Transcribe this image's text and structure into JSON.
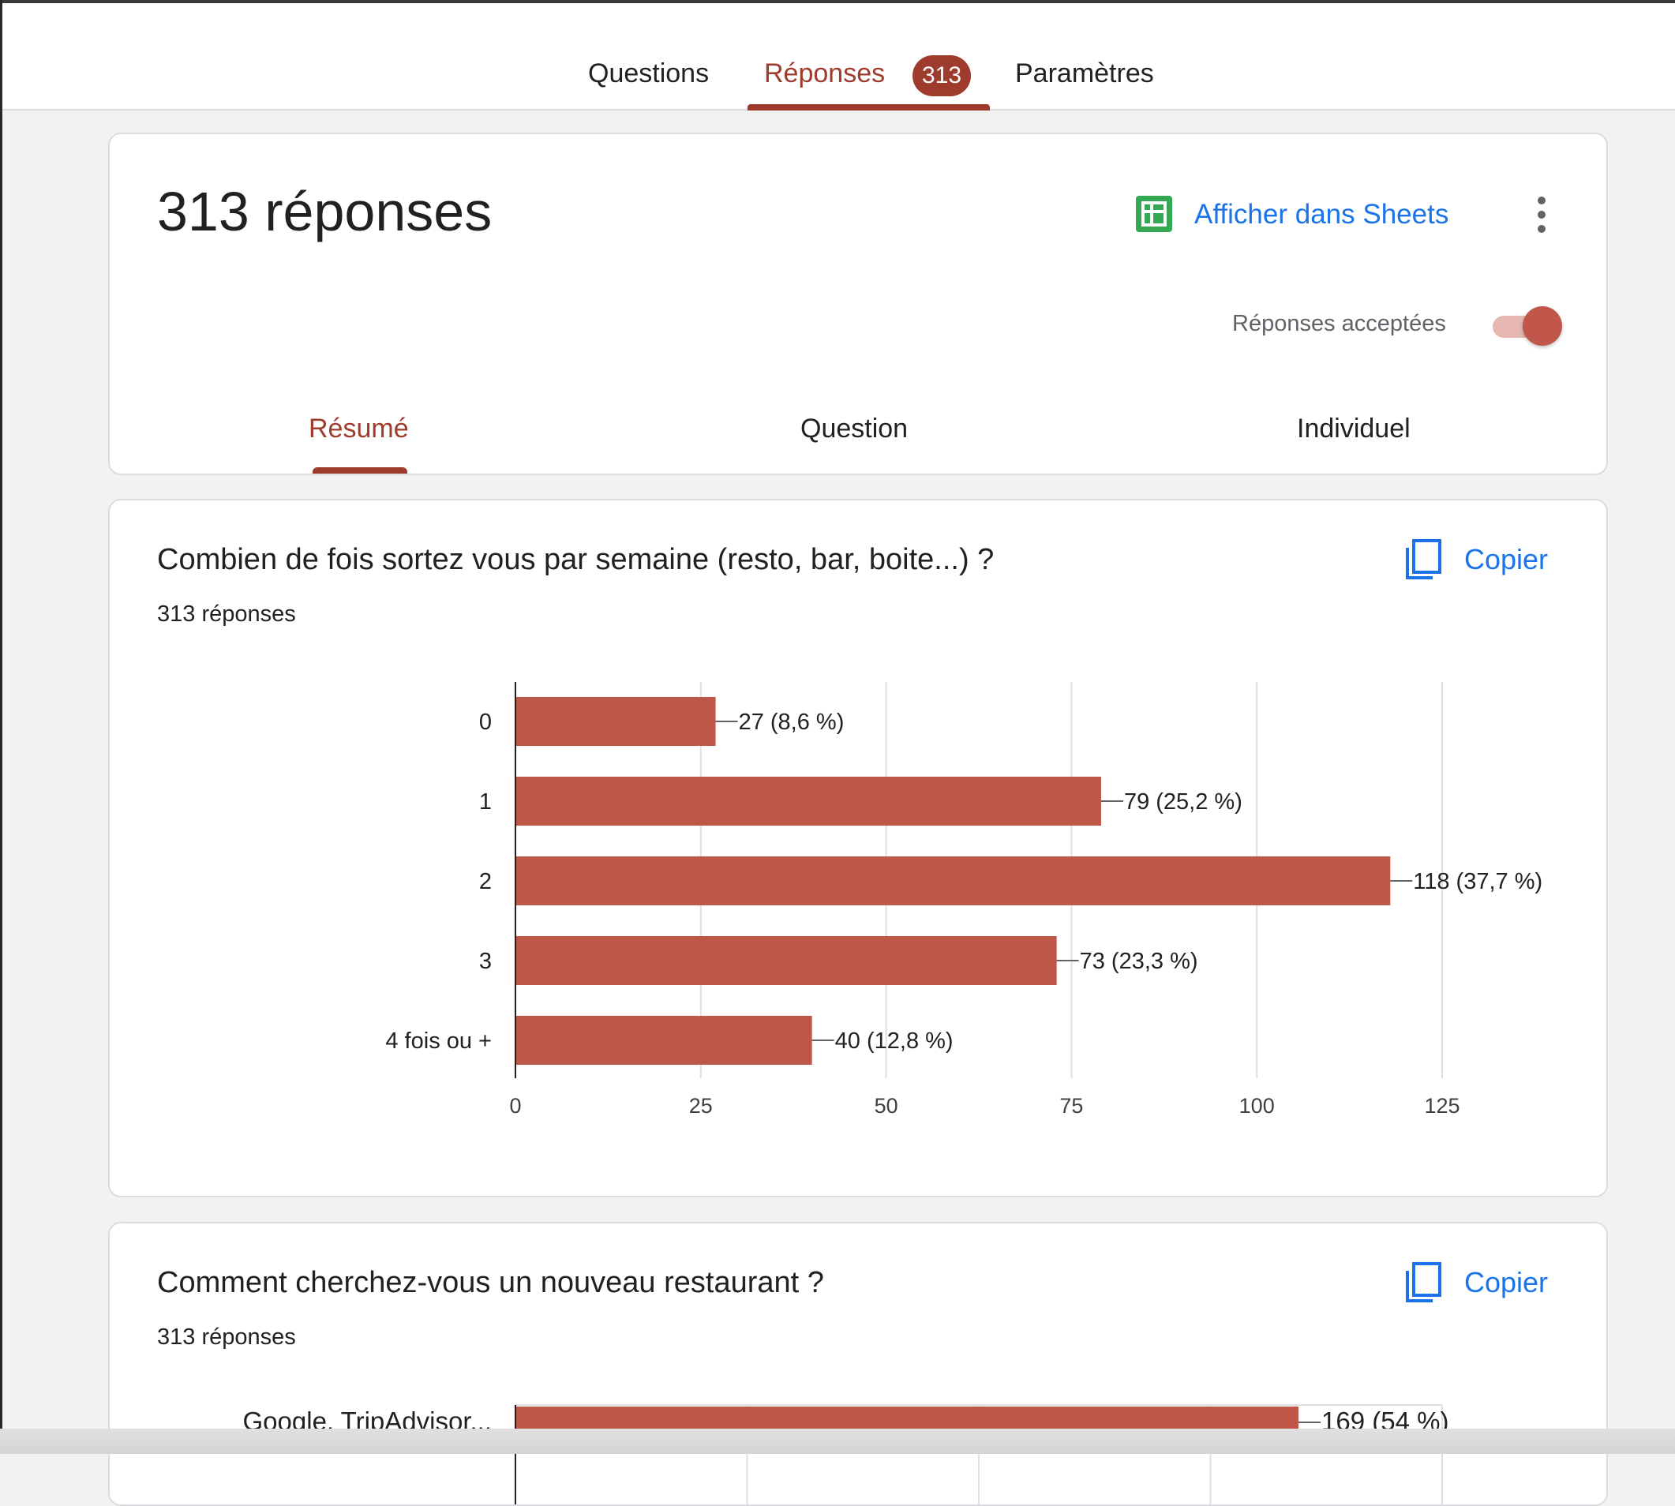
{
  "tabs": {
    "questions": "Questions",
    "responses": "Réponses",
    "responses_count": "313",
    "settings": "Paramètres"
  },
  "summary_card": {
    "title": "313 réponses",
    "sheets_link": "Afficher dans Sheets",
    "accepting_label": "Réponses acceptées",
    "accepting_on": true,
    "subtabs": {
      "summary": "Résumé",
      "question": "Question",
      "individual": "Individuel"
    }
  },
  "question1": {
    "title": "Combien de fois sortez vous par semaine (resto, bar, boite...) ?",
    "count": "313 réponses",
    "copy_label": "Copier"
  },
  "question2": {
    "title": "Comment cherchez-vous un nouveau restaurant ?",
    "count": "313 réponses",
    "copy_label": "Copier"
  },
  "colors": {
    "bar": "#bf5748",
    "accent": "#9e3b2c",
    "link": "#1a73e8",
    "sheets": "#34a853"
  },
  "chart_data": [
    {
      "type": "bar",
      "orientation": "horizontal",
      "categories": [
        "0",
        "1",
        "2",
        "3",
        "4 fois ou +"
      ],
      "values": [
        27,
        79,
        118,
        73,
        40
      ],
      "data_labels": [
        "27 (8,6 %)",
        "79 (25,2 %)",
        "118 (37,7 %)",
        "73 (23,3 %)",
        "40 (12,8 %)"
      ],
      "xticks": [
        0,
        25,
        50,
        75,
        100,
        125
      ],
      "xlim": [
        0,
        125
      ],
      "grid": true
    },
    {
      "type": "bar",
      "orientation": "horizontal",
      "categories": [
        "Google, TripAdvisor..."
      ],
      "values": [
        169
      ],
      "data_labels": [
        "169 (54 %)"
      ],
      "xlim": [
        0,
        200
      ],
      "grid": true
    }
  ]
}
